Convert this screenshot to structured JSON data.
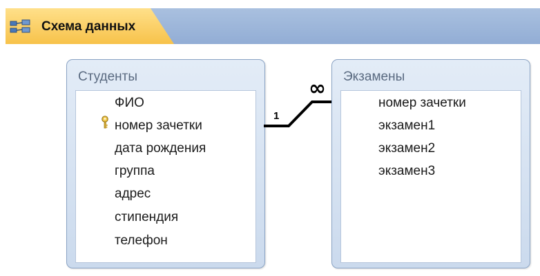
{
  "window": {
    "tab_title": "Схема данных",
    "tab_icon": "relationships-icon"
  },
  "tables": [
    {
      "name": "Студенты",
      "fields": [
        "ФИО",
        "номер зачетки",
        "дата рождения",
        "группа",
        "адрес",
        "стипендия",
        "телефон"
      ],
      "primary_key": "номер зачетки"
    },
    {
      "name": "Экзамены",
      "fields": [
        "номер зачетки",
        "экзамен1",
        "экзамен2",
        "экзамен3"
      ]
    }
  ],
  "relationship": {
    "from_label": "1",
    "to_label": "∞"
  }
}
